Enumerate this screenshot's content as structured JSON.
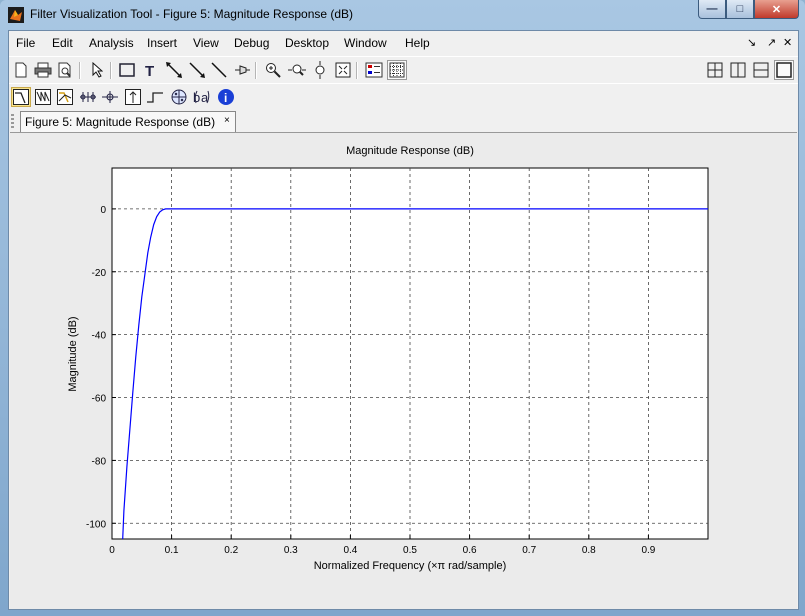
{
  "window": {
    "title": "Filter Visualization Tool - Figure 5: Magnitude Response (dB)"
  },
  "window_controls": {
    "minimize": "—",
    "maximize": "□",
    "close": "✕"
  },
  "menu": [
    {
      "label": "File"
    },
    {
      "label": "Edit"
    },
    {
      "label": "Analysis"
    },
    {
      "label": "Insert"
    },
    {
      "label": "View"
    },
    {
      "label": "Debug"
    },
    {
      "label": "Desktop"
    },
    {
      "label": "Window"
    },
    {
      "label": "Help"
    }
  ],
  "menu_right": {
    "dock": "↘",
    "undock": "↗",
    "close": "✕"
  },
  "figure_tab": {
    "label": "Figure 5: Magnitude Response (dB)",
    "close": "×"
  },
  "colors": {
    "plot_line": "#0000ff",
    "grid": "#444444",
    "info": "#1a3fd6"
  },
  "chart_data": {
    "type": "line",
    "title": "Magnitude Response (dB)",
    "xlabel": "Normalized Frequency (×π rad/sample)",
    "ylabel": "Magnitude (dB)",
    "xlim": [
      0,
      1
    ],
    "ylim": [
      -105,
      13
    ],
    "xticks": [
      0,
      0.1,
      0.2,
      0.3,
      0.4,
      0.5,
      0.6,
      0.7,
      0.8,
      0.9
    ],
    "xtick_labels": [
      "0",
      "0.1",
      "0.2",
      "0.3",
      "0.4",
      "0.5",
      "0.6",
      "0.7",
      "0.8",
      "0.9"
    ],
    "yticks": [
      0,
      -20,
      -40,
      -60,
      -80,
      -100
    ],
    "ytick_labels": [
      "0",
      "-20",
      "-40",
      "-60",
      "-80",
      "-100"
    ],
    "grid": true,
    "series": [
      {
        "x": [
          0.018,
          0.02,
          0.025,
          0.03,
          0.035,
          0.04,
          0.045,
          0.05,
          0.055,
          0.06,
          0.065,
          0.07,
          0.075,
          0.08,
          0.085,
          0.09,
          0.1,
          0.2,
          0.4,
          0.6,
          0.8,
          1.0
        ],
        "y": [
          -105,
          -96,
          -82,
          -70,
          -58,
          -47,
          -37,
          -28,
          -21,
          -14,
          -9,
          -5,
          -2.5,
          -1,
          -0.3,
          0,
          0,
          0,
          0,
          0,
          0,
          0
        ]
      }
    ]
  }
}
